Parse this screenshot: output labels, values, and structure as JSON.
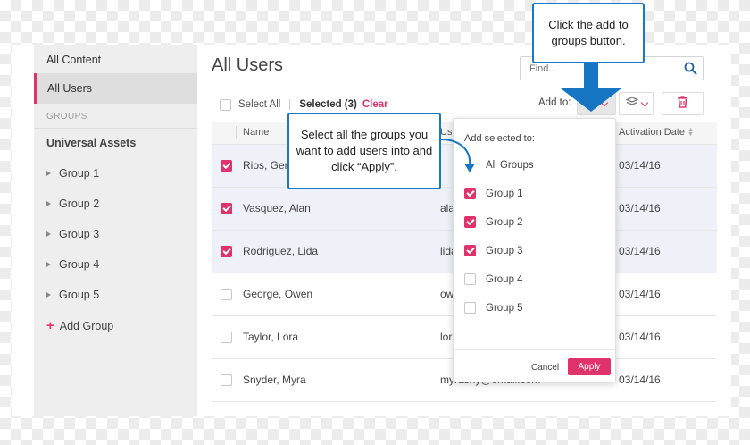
{
  "sidebar": {
    "all_content": "All Content",
    "all_users": "All Users",
    "groups_heading": "GROUPS",
    "universal_assets": "Universal Assets",
    "groups": [
      "Group 1",
      "Group 2",
      "Group 3",
      "Group 4",
      "Group 5"
    ],
    "add_group": "Add Group"
  },
  "main": {
    "title": "All Users",
    "search_placeholder": "Find..."
  },
  "toolbar": {
    "select_all": "Select All",
    "selected": "Selected (3)",
    "clear": "Clear",
    "add_to": "Add to:"
  },
  "table": {
    "columns": [
      "Name",
      "Use",
      "Activation Date"
    ],
    "rows": [
      {
        "name": "Rios, Geral",
        "email": "",
        "date": "03/14/16",
        "checked": true
      },
      {
        "name": "Vasquez, Alan",
        "email": "alan",
        "date": "03/14/16",
        "checked": true
      },
      {
        "name": "Rodriguez, Lida",
        "email": "lida",
        "date": "03/14/16",
        "checked": true
      },
      {
        "name": "George, Owen",
        "email": "owe",
        "date": "03/14/16",
        "checked": false
      },
      {
        "name": "Taylor, Lora",
        "email": "lora",
        "date": "03/14/16",
        "checked": false
      },
      {
        "name": "Snyder, Myra",
        "email": "myrasny@email.com",
        "date": "03/14/16",
        "checked": false
      }
    ]
  },
  "dropdown": {
    "title": "Add selected to:",
    "items": [
      {
        "label": "All Groups",
        "checked": false
      },
      {
        "label": "Group 1",
        "checked": true
      },
      {
        "label": "Group 2",
        "checked": true
      },
      {
        "label": "Group 3",
        "checked": true
      },
      {
        "label": "Group 4",
        "checked": false
      },
      {
        "label": "Group 5",
        "checked": false
      }
    ],
    "cancel": "Cancel",
    "apply": "Apply"
  },
  "callouts": {
    "top": "Click the add to groups button.",
    "middle": "Select all the groups you want to add users into and click “Apply”."
  },
  "colors": {
    "accent": "#e0336b",
    "callout_border": "#1979c6",
    "arrow": "#1676c4"
  },
  "icons": {
    "search": "search-icon",
    "add_to_groups": "stack-icon",
    "delete": "trash-icon"
  }
}
